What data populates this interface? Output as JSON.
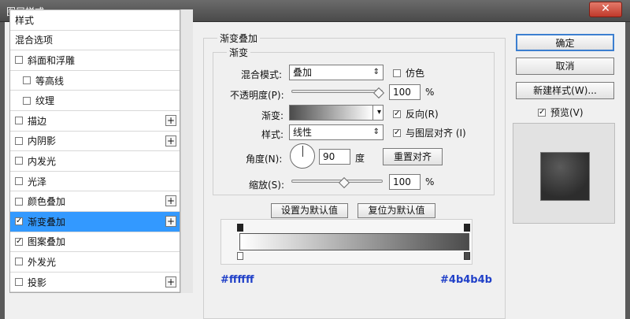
{
  "window": {
    "title": "图层样式",
    "close": "✕"
  },
  "style_list": {
    "items": [
      {
        "label": "样式",
        "checkbox": false,
        "checked": false,
        "sub": false,
        "plus": false,
        "selected": false
      },
      {
        "label": "混合选项",
        "checkbox": false,
        "checked": false,
        "sub": false,
        "plus": false,
        "selected": false
      },
      {
        "label": "斜面和浮雕",
        "checkbox": true,
        "checked": false,
        "sub": false,
        "plus": false,
        "selected": false
      },
      {
        "label": "等高线",
        "checkbox": true,
        "checked": false,
        "sub": true,
        "plus": false,
        "selected": false
      },
      {
        "label": "纹理",
        "checkbox": true,
        "checked": false,
        "sub": true,
        "plus": false,
        "selected": false
      },
      {
        "label": "描边",
        "checkbox": true,
        "checked": false,
        "sub": false,
        "plus": true,
        "selected": false
      },
      {
        "label": "内阴影",
        "checkbox": true,
        "checked": false,
        "sub": false,
        "plus": true,
        "selected": false
      },
      {
        "label": "内发光",
        "checkbox": true,
        "checked": false,
        "sub": false,
        "plus": false,
        "selected": false
      },
      {
        "label": "光泽",
        "checkbox": true,
        "checked": false,
        "sub": false,
        "plus": false,
        "selected": false
      },
      {
        "label": "颜色叠加",
        "checkbox": true,
        "checked": false,
        "sub": false,
        "plus": true,
        "selected": false
      },
      {
        "label": "渐变叠加",
        "checkbox": true,
        "checked": true,
        "sub": false,
        "plus": true,
        "selected": true
      },
      {
        "label": "图案叠加",
        "checkbox": true,
        "checked": true,
        "sub": false,
        "plus": false,
        "selected": false
      },
      {
        "label": "外发光",
        "checkbox": true,
        "checked": false,
        "sub": false,
        "plus": false,
        "selected": false
      },
      {
        "label": "投影",
        "checkbox": true,
        "checked": false,
        "sub": false,
        "plus": true,
        "selected": false
      }
    ]
  },
  "panel": {
    "group_title": "渐变叠加",
    "subgroup_title": "渐变",
    "blend_mode_label": "混合模式:",
    "blend_mode_value": "叠加",
    "dither_label": "仿色",
    "opacity_label": "不透明度(P):",
    "opacity_value": "100",
    "percent": "%",
    "gradient_label": "渐变:",
    "reverse_label": "反向(R)",
    "style_label": "样式:",
    "style_value": "线性",
    "align_label": "与图层对齐 (I)",
    "angle_label": "角度(N):",
    "angle_value": "90",
    "degree_unit": "度",
    "reset_align_label": "重置对齐",
    "scale_label": "缩放(S):",
    "scale_value": "100",
    "set_default_label": "设置为默认值",
    "reset_default_label": "复位为默认值",
    "color_left": "#ffffff",
    "color_right": "#4b4b4b"
  },
  "buttons": {
    "ok": "确定",
    "cancel": "取消",
    "new_style": "新建样式(W)...",
    "preview": "预览(V)"
  },
  "colors": {
    "selected": "#3399ff",
    "accent_text": "#2040c8"
  }
}
